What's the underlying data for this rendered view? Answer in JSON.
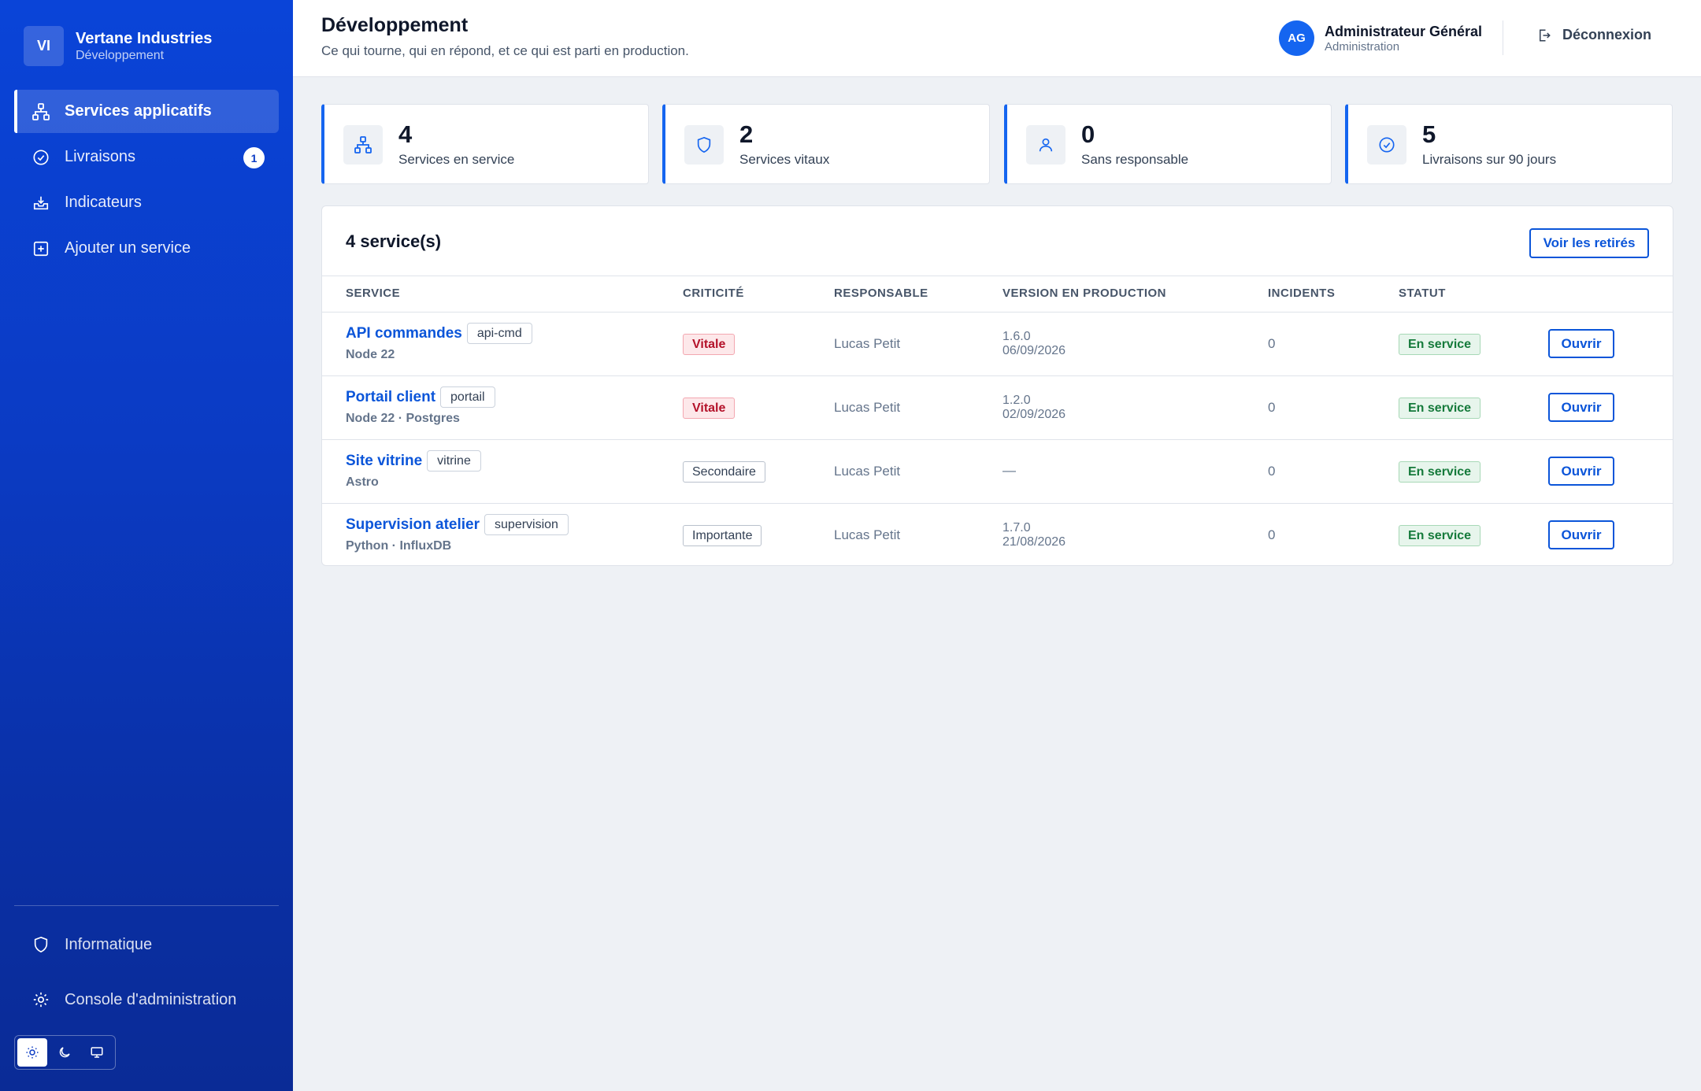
{
  "brand": {
    "initials": "VI",
    "name": "Vertane Industries",
    "subtitle": "Développement"
  },
  "sidebar": {
    "items": [
      {
        "label": "Services applicatifs",
        "icon": "network-icon",
        "active": true
      },
      {
        "label": "Livraisons",
        "icon": "check-circle-icon",
        "badge": "1"
      },
      {
        "label": "Indicateurs",
        "icon": "inbox-download-icon"
      },
      {
        "label": "Ajouter un service",
        "icon": "plus-square-icon"
      }
    ],
    "bottom_items": [
      {
        "label": "Informatique",
        "icon": "shield-icon"
      },
      {
        "label": "Console d'administration",
        "icon": "gear-icon"
      }
    ],
    "theme_options": [
      "sun-icon",
      "moon-icon",
      "monitor-icon"
    ]
  },
  "header": {
    "title": "Développement",
    "subtitle": "Ce qui tourne, qui en répond, et ce qui est parti en production.",
    "user": {
      "initials": "AG",
      "name": "Administrateur Général",
      "role": "Administration"
    },
    "logout_label": "Déconnexion"
  },
  "stats": [
    {
      "value": "4",
      "label": "Services en service",
      "icon": "network-icon"
    },
    {
      "value": "2",
      "label": "Services vitaux",
      "icon": "shield-icon"
    },
    {
      "value": "0",
      "label": "Sans responsable",
      "icon": "user-icon"
    },
    {
      "value": "5",
      "label": "Livraisons sur 90 jours",
      "icon": "check-circle-icon"
    }
  ],
  "table": {
    "title": "4 service(s)",
    "retired_button": "Voir les retirés",
    "columns": [
      "SERVICE",
      "CRITICITÉ",
      "RESPONSABLE",
      "VERSION EN PRODUCTION",
      "INCIDENTS",
      "STATUT"
    ],
    "rows": [
      {
        "name": "API commandes",
        "tag": "api-cmd",
        "tech": "Node 22",
        "criticity": "Vitale",
        "owner": "Lucas Petit",
        "version": "1.6.0",
        "date": "06/09/2026",
        "incidents": "0",
        "status": "En service",
        "action": "Ouvrir"
      },
      {
        "name": "Portail client",
        "tag": "portail",
        "tech": "Node 22 · Postgres",
        "criticity": "Vitale",
        "owner": "Lucas Petit",
        "version": "1.2.0",
        "date": "02/09/2026",
        "incidents": "0",
        "status": "En service",
        "action": "Ouvrir"
      },
      {
        "name": "Site vitrine",
        "tag": "vitrine",
        "tech": "Astro",
        "criticity": "Secondaire",
        "owner": "Lucas Petit",
        "version": "—",
        "date": "",
        "incidents": "0",
        "status": "En service",
        "action": "Ouvrir"
      },
      {
        "name": "Supervision atelier",
        "tag": "supervision",
        "tech": "Python · InfluxDB",
        "criticity": "Importante",
        "owner": "Lucas Petit",
        "version": "1.7.0",
        "date": "21/08/2026",
        "incidents": "0",
        "status": "En service",
        "action": "Ouvrir"
      }
    ]
  },
  "colors": {
    "accent": "#1565f0",
    "sidebar": "#0b3bc4",
    "danger": "#b4122a",
    "success": "#157a3b"
  }
}
